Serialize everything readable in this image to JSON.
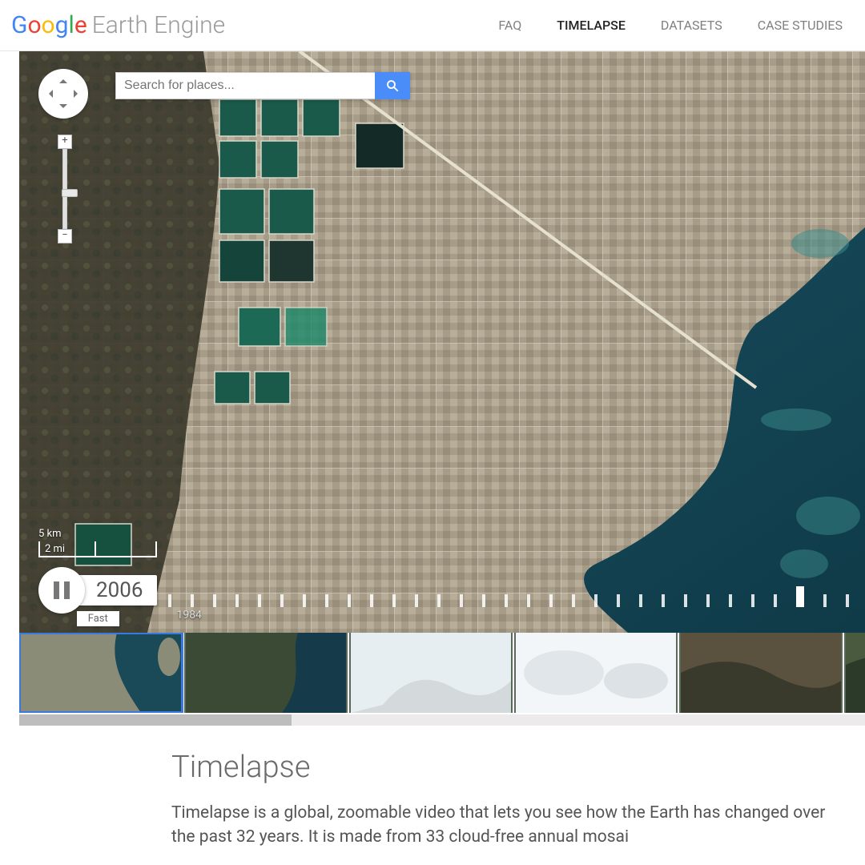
{
  "header": {
    "logo_google": "Google",
    "logo_rest": "Earth Engine",
    "nav": [
      {
        "label": "FAQ",
        "active": false
      },
      {
        "label": "TIMELAPSE",
        "active": true
      },
      {
        "label": "DATASETS",
        "active": false
      },
      {
        "label": "CASE STUDIES",
        "active": false
      }
    ]
  },
  "search": {
    "placeholder": "Search for places..."
  },
  "scale": {
    "km": "5 km",
    "mi": "2 mi"
  },
  "playback": {
    "state": "pause",
    "year": "2006",
    "speed": "Fast",
    "start_year": "1984",
    "tick_count": 33,
    "current_tick_index": 28
  },
  "thumb_count": 6,
  "article": {
    "title": "Timelapse",
    "body": "Timelapse is a global, zoomable video that lets you see how the Earth has changed over the past 32 years. It is made from 33 cloud-free annual mosai"
  }
}
